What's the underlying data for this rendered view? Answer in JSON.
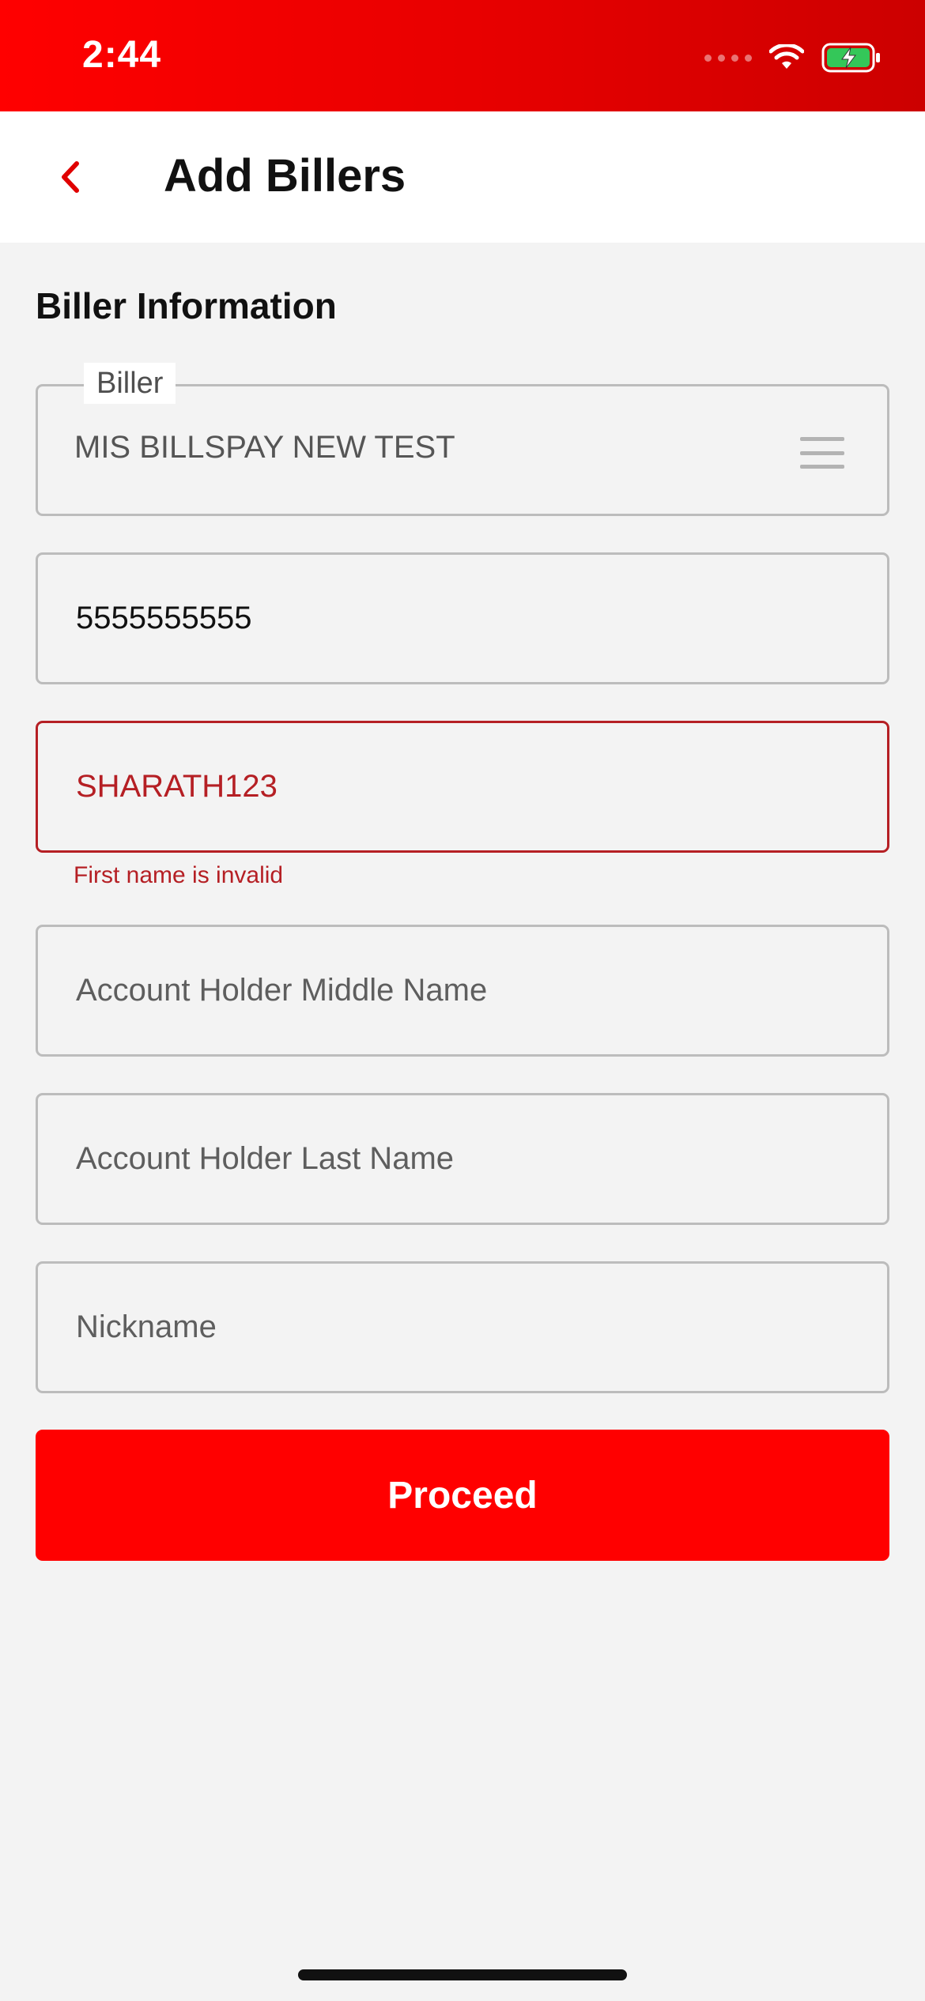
{
  "status_bar": {
    "time": "2:44"
  },
  "header": {
    "title": "Add Billers",
    "back_icon": "chevron-left-icon"
  },
  "section": {
    "title": "Biller Information"
  },
  "form": {
    "biller": {
      "legend": "Biller",
      "value": "MIS BILLSPAY NEW TEST",
      "icon": "menu-icon"
    },
    "account_number": {
      "value": "5555555555",
      "placeholder": ""
    },
    "first_name": {
      "value": "SHARATH123",
      "error": "First name is invalid"
    },
    "middle_name": {
      "value": "",
      "placeholder": "Account Holder Middle Name"
    },
    "last_name": {
      "value": "",
      "placeholder": "Account Holder Last Name"
    },
    "nickname": {
      "value": "",
      "placeholder": "Nickname"
    }
  },
  "actions": {
    "proceed_label": "Proceed"
  },
  "colors": {
    "brand_red": "#ff0000",
    "error_red": "#b51f24",
    "background": "#f3f3f3",
    "border_gray": "#bcbcbc"
  }
}
